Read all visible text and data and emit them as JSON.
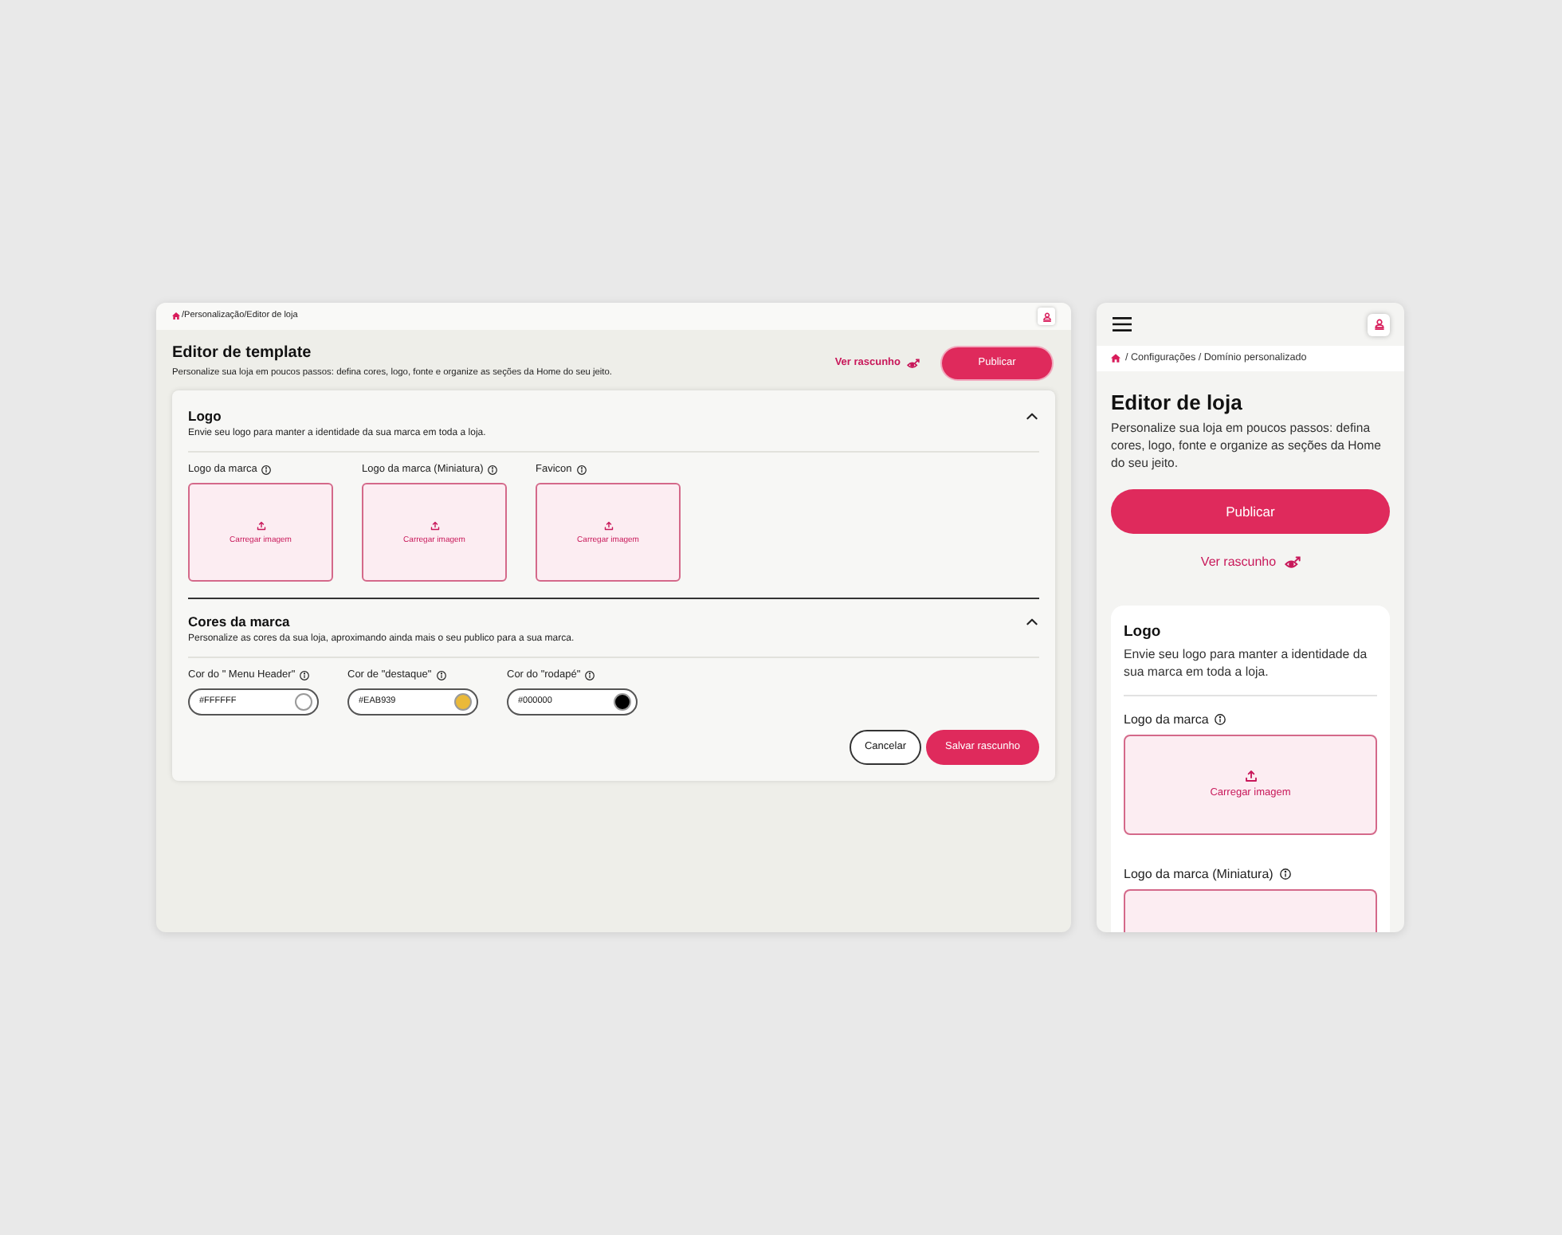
{
  "desktop": {
    "breadcrumb": "/Personalização/Editor de loja",
    "header": {
      "title": "Editor de template",
      "subtitle": "Personalize sua loja em poucos passos: defina cores, logo, fonte e organize as seções da Home do seu jeito.",
      "draft_link": "Ver rascunho",
      "publish_button": "Publicar"
    },
    "sections": [
      {
        "kind": "uploads",
        "title": "Logo",
        "description": "Envie seu logo para manter a identidade da sua marca em toda a loja.",
        "expanded": true,
        "fields": [
          {
            "label": "Logo da marca",
            "upload_text": "Carregar imagem"
          },
          {
            "label": "Logo da marca (Miniatura)",
            "upload_text": "Carregar imagem"
          },
          {
            "label": "Favicon",
            "upload_text": "Carregar imagem"
          }
        ]
      },
      {
        "kind": "colors",
        "title": "Cores da marca",
        "description": "Personalize as cores da sua loja, aproximando ainda mais o seu publico para a sua marca.",
        "expanded": true,
        "fields": [
          {
            "label": "Cor do \" Menu Header\"",
            "value": "#FFFFFF",
            "color": "#ffffff"
          },
          {
            "label": "Cor de \"destaque\"",
            "value": "#EAB939",
            "color": "#eab939"
          },
          {
            "label": "Cor do \"rodapé\"",
            "value": "#000000",
            "color": "#000000"
          }
        ]
      }
    ],
    "actions": {
      "cancel_button": "Cancelar",
      "save_button": "Salvar rascunho"
    }
  },
  "mobile": {
    "breadcrumb": "/ Configurações / Domínio personalizado",
    "title": "Editor de loja",
    "subtitle": "Personalize sua loja em poucos passos: defina cores, logo, fonte e organize as seções da Home do seu jeito.",
    "publish_button": "Publicar",
    "draft_link": "Ver rascunho",
    "card": {
      "title": "Logo",
      "description": "Envie seu logo para manter a identidade da sua marca em toda a loja.",
      "fields": [
        {
          "label": "Logo da marca",
          "upload_text": "Carregar imagem"
        },
        {
          "label": "Logo da marca (Miniatura)"
        }
      ]
    }
  }
}
